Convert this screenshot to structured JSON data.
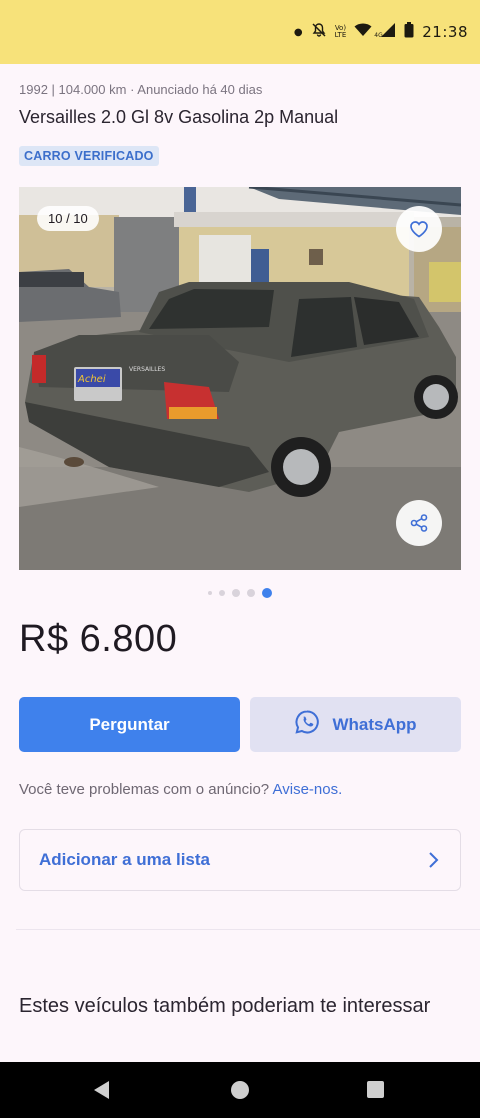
{
  "status_bar": {
    "time": "21:38",
    "network_top": "Vo)",
    "network_bottom": "LTE",
    "signal_small": "4G",
    "icons": [
      "dot-icon",
      "mute-bell-icon",
      "volte-icon",
      "wifi-icon",
      "signal-icon",
      "battery-icon"
    ]
  },
  "listing": {
    "meta": "1992 | 104.000 km · Anunciado há 40 dias",
    "title": "Versailles 2.0 Gl 8v Gasolina 2p Manual",
    "badge": "CARRO VERIFICADO",
    "photo_counter": "10 / 10",
    "plate_text": "Achei",
    "model_badge": "VERSAILLES",
    "price": "R$ 6.800"
  },
  "carousel": {
    "total_dots_visible": 5,
    "active_index": 4
  },
  "actions": {
    "ask_label": "Perguntar",
    "whatsapp_label": "WhatsApp"
  },
  "report": {
    "text": "Você teve problemas com o anúncio? ",
    "link": "Avise-nos."
  },
  "list_card": {
    "label": "Adicionar a uma lista"
  },
  "related": {
    "title": "Estes veículos também poderiam te interessar"
  },
  "colors": {
    "status_bar": "#f7e27a",
    "accent": "#3f81ec",
    "link": "#3f6fd6",
    "whatsapp_bg": "#e1e1f2",
    "background": "#fdf6fb"
  }
}
